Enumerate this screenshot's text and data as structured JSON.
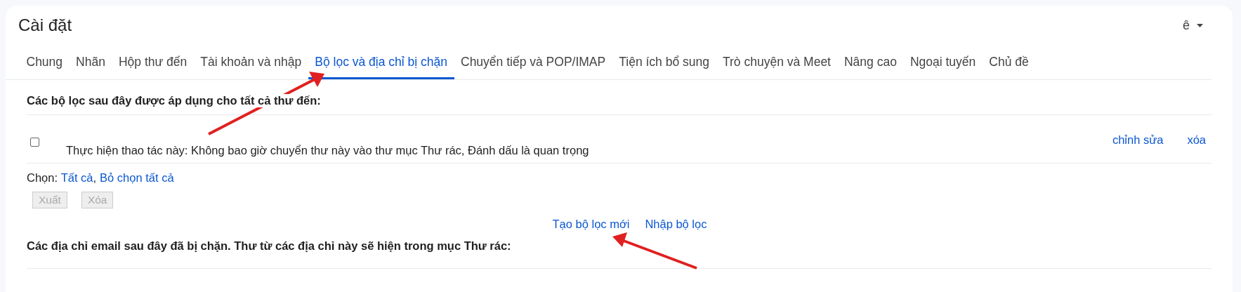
{
  "window": {
    "title": "Cài đặt",
    "account_menu": "ê"
  },
  "tabs": [
    {
      "label": "Chung",
      "selected": false
    },
    {
      "label": "Nhãn",
      "selected": false
    },
    {
      "label": "Hộp thư đến",
      "selected": false
    },
    {
      "label": "Tài khoản và nhập",
      "selected": false
    },
    {
      "label": "Bộ lọc và địa chỉ bị chặn",
      "selected": true
    },
    {
      "label": "Chuyển tiếp và POP/IMAP",
      "selected": false
    },
    {
      "label": "Tiện ích bổ sung",
      "selected": false
    },
    {
      "label": "Trò chuyện và Meet",
      "selected": false
    },
    {
      "label": "Nâng cao",
      "selected": false
    },
    {
      "label": "Ngoại tuyến",
      "selected": false
    },
    {
      "label": "Chủ đề",
      "selected": false
    }
  ],
  "filters": {
    "heading": "Các bộ lọc sau đây được áp dụng cho tất cả thư đến:",
    "rows": [
      {
        "checked": false,
        "description": "Thực hiện thao tác này: Không bao giờ chuyển thư này vào thư mục Thư rác, Đánh dấu là quan trọng",
        "actions": [
          "chỉnh sửa",
          "xóa"
        ]
      }
    ],
    "select_label": "Chọn:",
    "select_links": [
      "Tất cả",
      "Bỏ chọn tất cả"
    ],
    "select_separator": ",",
    "buttons": [
      {
        "label": "Xuất",
        "disabled": true
      },
      {
        "label": "Xóa",
        "disabled": true
      }
    ],
    "links": [
      "Tạo bộ lọc mới",
      "Nhập bộ lọc"
    ]
  },
  "blocked": {
    "heading": "Các địa chỉ email sau đây đã bị chặn. Thư từ các địa chỉ này sẽ hiện trong mục Thư rác:"
  }
}
